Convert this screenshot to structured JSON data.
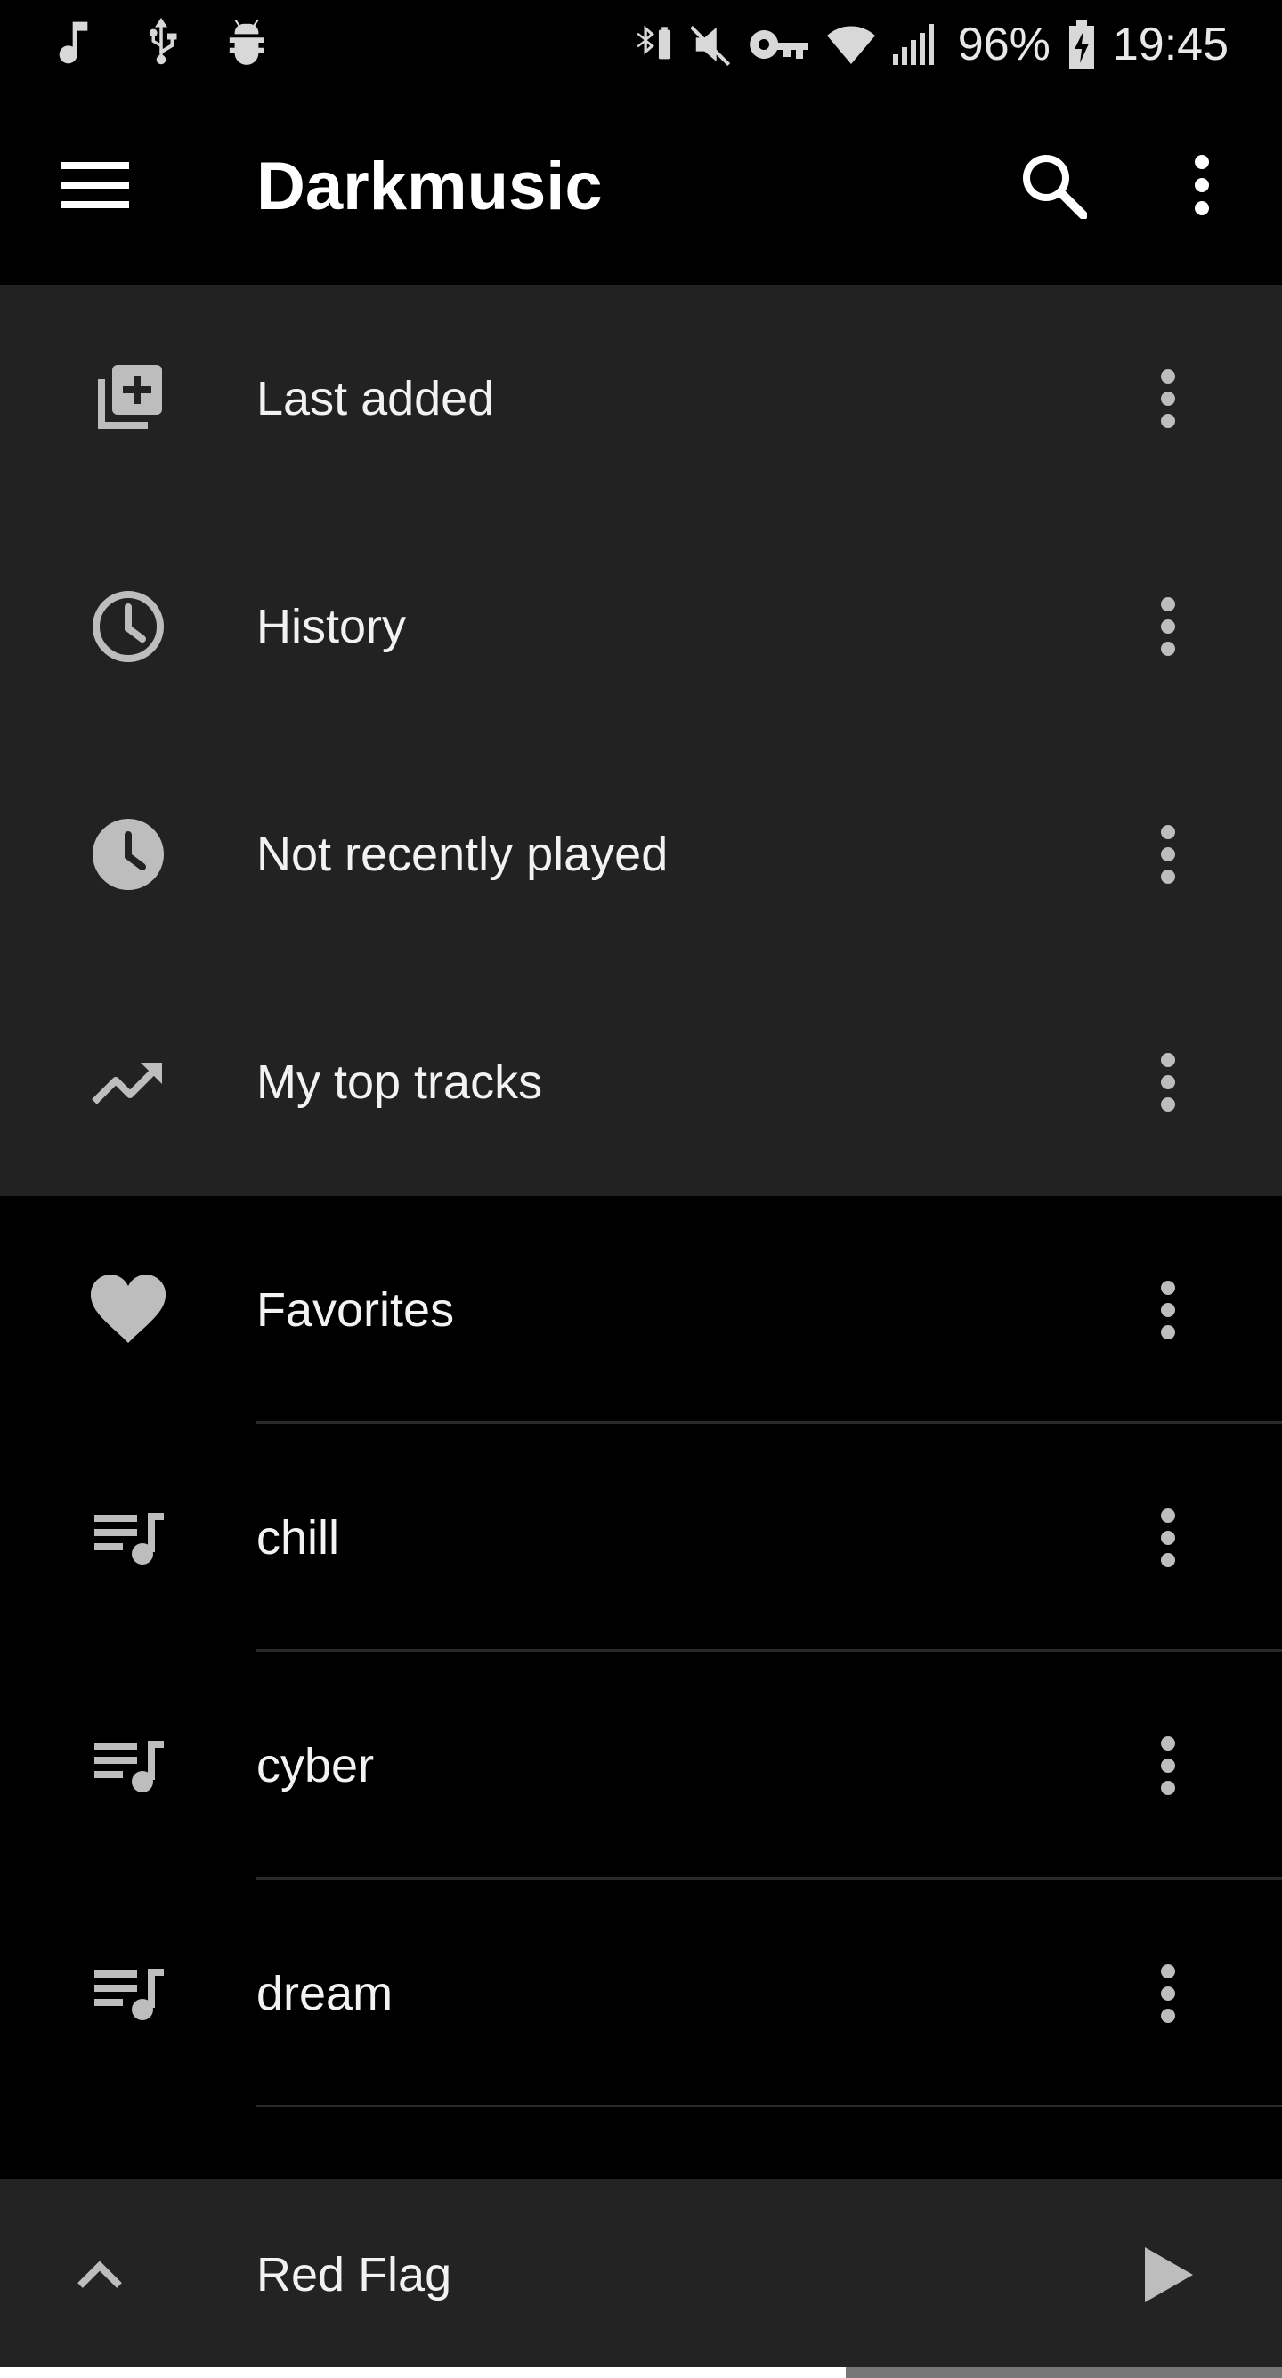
{
  "status_bar": {
    "left_icons": [
      "music-note-icon",
      "usb-icon",
      "android-debug-icon"
    ],
    "right_icons": [
      "bluetooth-battery-icon",
      "muted-icon",
      "vpn-key-icon",
      "wifi-icon",
      "signal-icon"
    ],
    "battery_percent": "96%",
    "time": "19:45"
  },
  "app_bar": {
    "title": "Darkmusic"
  },
  "smart_playlists": [
    {
      "label": "Last added",
      "icon": "library-add-icon"
    },
    {
      "label": "History",
      "icon": "clock-outline-icon"
    },
    {
      "label": "Not recently played",
      "icon": "clock-filled-icon"
    },
    {
      "label": "My top tracks",
      "icon": "trending-up-icon"
    }
  ],
  "playlists": [
    {
      "label": "Favorites",
      "icon": "heart-icon"
    },
    {
      "label": "chill",
      "icon": "playlist-music-icon"
    },
    {
      "label": "cyber",
      "icon": "playlist-music-icon"
    },
    {
      "label": "dream",
      "icon": "playlist-music-icon"
    }
  ],
  "mini_player": {
    "track_title": "Red Flag",
    "progress": 0.66
  },
  "colors": {
    "background": "#000000",
    "section_bg": "#222222",
    "mini_player_bg": "#232323",
    "icon": "#bdbdbd"
  }
}
